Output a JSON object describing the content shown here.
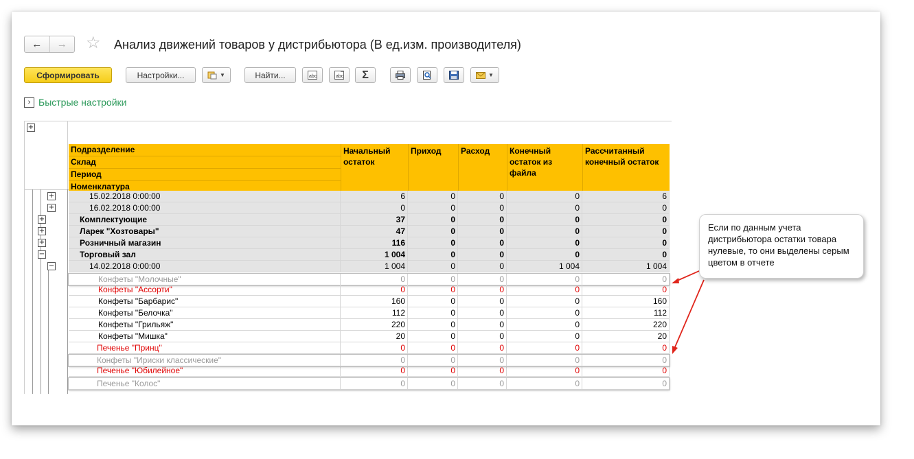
{
  "header": {
    "back_icon": "arrow-left-icon",
    "forward_icon": "arrow-right-icon",
    "favorite_icon": "star-icon",
    "title": "Анализ движений товаров у дистрибьютора (В ед.изм. производителя)"
  },
  "toolbar": {
    "generate_label": "Сформировать",
    "settings_label": "Настройки...",
    "find_label": "Найти...",
    "sum_symbol": "Σ"
  },
  "quick_settings": {
    "label": "Быстрые настройки"
  },
  "table": {
    "header": {
      "group_lines": [
        "Подразделение",
        "Склад",
        "Период",
        "Номенклатура"
      ],
      "columns": [
        "Начальный остаток",
        "Приход",
        "Расход",
        "Конечный остаток из файла",
        "Рассчитанный конечный остаток"
      ]
    },
    "rows": [
      {
        "label": "15.02.2018 0:00:00",
        "values": [
          "6",
          "0",
          "0",
          "0",
          "6"
        ]
      },
      {
        "label": "16.02.2018 0:00:00",
        "values": [
          "0",
          "0",
          "0",
          "0",
          "0"
        ]
      },
      {
        "label": "Комплектующие",
        "values": [
          "37",
          "0",
          "0",
          "0",
          "0"
        ]
      },
      {
        "label": "Ларек \"Хозтовары\"",
        "values": [
          "47",
          "0",
          "0",
          "0",
          "0"
        ]
      },
      {
        "label": "Розничный магазин",
        "values": [
          "116",
          "0",
          "0",
          "0",
          "0"
        ]
      },
      {
        "label": "Торговый зал",
        "values": [
          "1 004",
          "0",
          "0",
          "0",
          "0"
        ]
      },
      {
        "label": "14.02.2018 0:00:00",
        "values": [
          "1 004",
          "0",
          "0",
          "1 004",
          "1 004"
        ]
      },
      {
        "label": "Конфеты \"Молочные\"",
        "values": [
          "0",
          "0",
          "0",
          "0",
          "0"
        ]
      },
      {
        "label": "Конфеты \"Ассорти\"",
        "values": [
          "0",
          "0",
          "0",
          "0",
          "0"
        ]
      },
      {
        "label": "Конфеты \"Барбарис\"",
        "values": [
          "160",
          "0",
          "0",
          "0",
          "160"
        ]
      },
      {
        "label": "Конфеты \"Белочка\"",
        "values": [
          "112",
          "0",
          "0",
          "0",
          "112"
        ]
      },
      {
        "label": "Конфеты \"Грильяж\"",
        "values": [
          "220",
          "0",
          "0",
          "0",
          "220"
        ]
      },
      {
        "label": "Конфеты \"Мишка\"",
        "values": [
          "20",
          "0",
          "0",
          "0",
          "20"
        ]
      },
      {
        "label": "Печенье \"Принц\"",
        "values": [
          "0",
          "0",
          "0",
          "0",
          "0"
        ]
      },
      {
        "label": "Конфеты \"Ириски классические\"",
        "values": [
          "0",
          "0",
          "0",
          "0",
          "0"
        ]
      },
      {
        "label": "Печенье \"Юбилейное\"",
        "values": [
          "0",
          "0",
          "0",
          "0",
          "0"
        ]
      },
      {
        "label": "Печенье \"Колос\"",
        "values": [
          "0",
          "0",
          "0",
          "0",
          "0"
        ]
      }
    ]
  },
  "callout": {
    "text": "Если по данным учета дистрибьютора остатки товара нулевые, то они выделены серым цветом в отчете"
  },
  "colors": {
    "header_yellow": "#fec000",
    "primary_button": "#f5cd19",
    "quick_settings_green": "#2d9a5b",
    "zero_gray": "#9a9a9a",
    "negative_red": "#e00000",
    "arrow_red": "#e0251b"
  }
}
